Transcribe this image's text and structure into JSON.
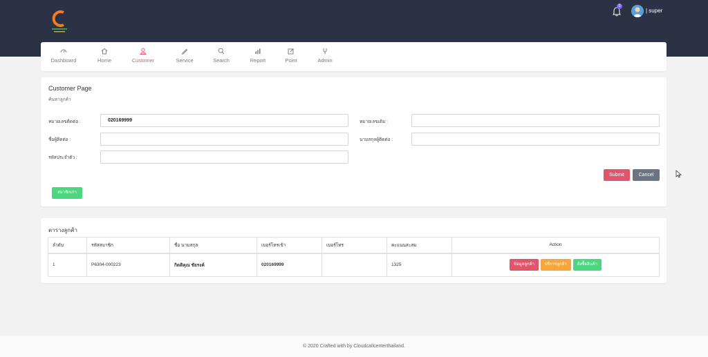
{
  "header": {
    "username": "| super",
    "notification_count": "0"
  },
  "nav": [
    {
      "label": "Dashboard",
      "icon": "dashboard-icon"
    },
    {
      "label": "Home",
      "icon": "home-icon"
    },
    {
      "label": "Customer",
      "icon": "user-icon"
    },
    {
      "label": "Service",
      "icon": "pencil-icon"
    },
    {
      "label": "Search",
      "icon": "search-icon"
    },
    {
      "label": "Report",
      "icon": "bar-chart-icon"
    },
    {
      "label": "Point",
      "icon": "edit-icon"
    },
    {
      "label": "Admin",
      "icon": "admin-icon"
    }
  ],
  "search": {
    "title": "Customer Page",
    "subtitle": "ค้นหาลูกค้า",
    "phone_label": "หมายเลขติดต่อ :",
    "phone_value": "020169999",
    "old_number_label": "หมายเลขเดิม :",
    "old_number_value": "",
    "contact_name_label": "ชื่อผู้ติดต่อ :",
    "contact_name_value": "",
    "contact_surname_label": "นามสกุลผู้ติดต่อ :",
    "contact_surname_value": "",
    "id_card_label": "รหัสประจำตัว :",
    "id_card_value": "",
    "submit_label": "Submit",
    "cancel_label": "Cancel",
    "register_label": "สมาชิกเก่า"
  },
  "table": {
    "title": "ตารางลูกค้า",
    "headers": [
      "ลำดับ",
      "รหัสสมาชิก",
      "ชื่อ นามสกุล",
      "เบอร์โทรเข้า",
      "เบอร์โทร",
      "คะแนนสะสม",
      "Action"
    ],
    "rows": [
      {
        "index": "1",
        "member_id": "P6304-000223",
        "name": "กิตติคุณ ชัยรงค์",
        "incoming_phone": "020169999",
        "phone": "",
        "points": "1325",
        "actions": [
          "ข้อมูลลูกค้า",
          "บริการลูกค้า",
          "สั่งซื้อสินค้า"
        ]
      }
    ]
  },
  "footer": {
    "text": "© 2020 Crafted with by Cloudcallcenterthailand."
  },
  "colors": {
    "topbar": "#2c3245",
    "accent": "#e0546c",
    "cancel": "#6b7480",
    "green": "#4cd77e",
    "orange": "#f6a63d"
  }
}
